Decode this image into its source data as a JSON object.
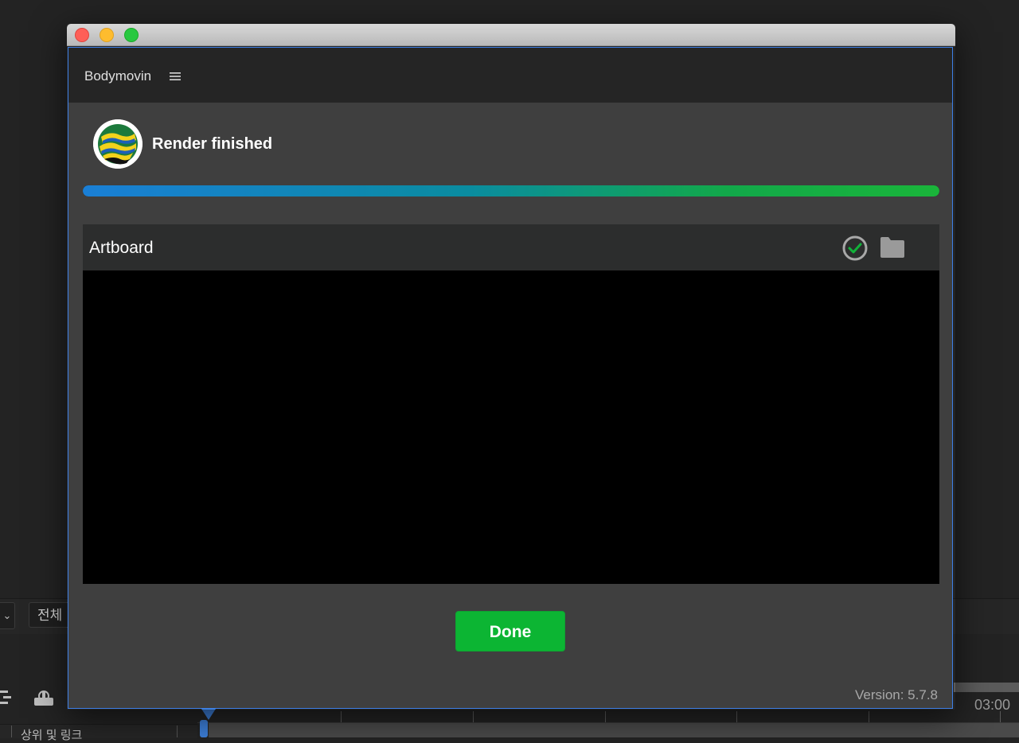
{
  "background_app": {
    "filter_label": "전체",
    "layer_header_label": "상위 및 링크",
    "timecode": "03:00"
  },
  "window": {
    "app_title": "Bodymovin",
    "status_title": "Render finished",
    "progress_fraction": 1.0,
    "composition": {
      "name": "Artboard",
      "status_icon": "check-circle-icon",
      "folder_icon": "folder-icon"
    },
    "done_label": "Done",
    "version_label": "Version: 5.7.8"
  },
  "colors": {
    "accent_green": "#0cb533",
    "progress_start": "#1a7fd6",
    "progress_end": "#1ab53a",
    "window_border": "#3d7fe6"
  }
}
